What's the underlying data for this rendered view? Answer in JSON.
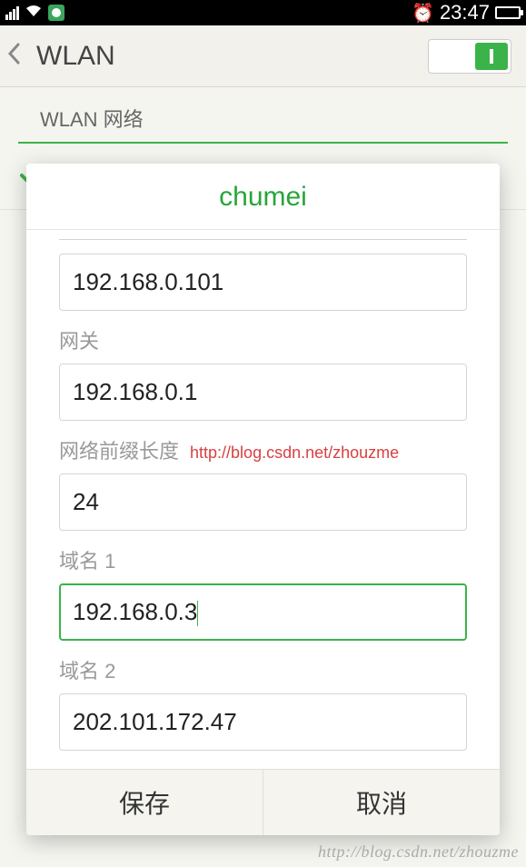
{
  "statusbar": {
    "time": "23:47"
  },
  "header": {
    "title": "WLAN"
  },
  "section": {
    "label": "WLAN 网络"
  },
  "network": {
    "name": "chumei"
  },
  "dialog": {
    "title": "chumei",
    "fields": {
      "ip": {
        "value": "192.168.0.101"
      },
      "gateway": {
        "label": "网关",
        "value": "192.168.0.1"
      },
      "prefix": {
        "label": "网络前缀长度",
        "watermark": "http://blog.csdn.net/zhouzme",
        "value": "24"
      },
      "dns1": {
        "label": "域名 1",
        "value": "192.168.0.3"
      },
      "dns2": {
        "label": "域名 2",
        "value": "202.101.172.47"
      }
    },
    "actions": {
      "save": "保存",
      "cancel": "取消"
    }
  },
  "watermark": "http://blog.csdn.net/zhouzme"
}
